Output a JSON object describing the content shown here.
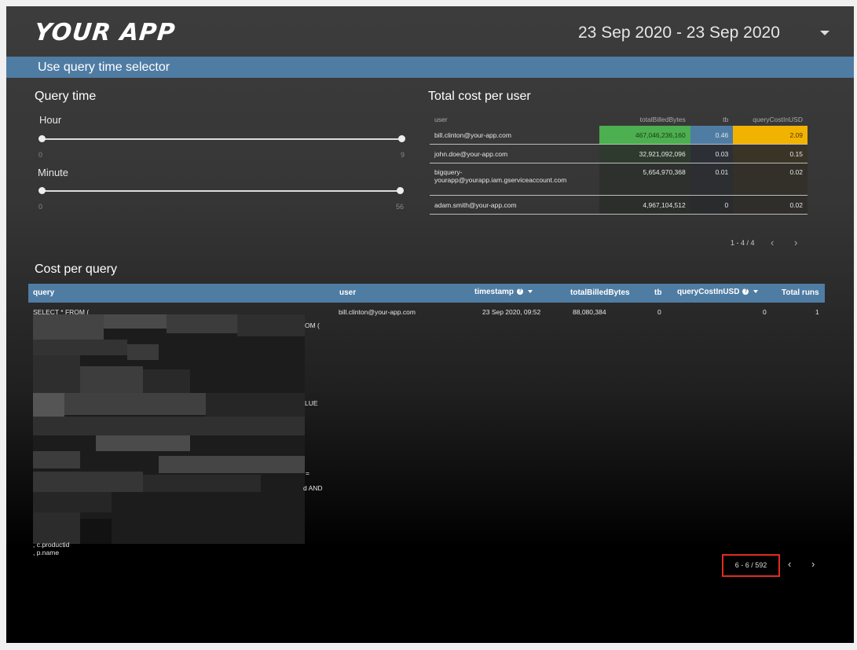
{
  "header": {
    "logo": "YOUR APP",
    "date_range": "23 Sep 2020 - 23 Sep 2020"
  },
  "banner": {
    "text": "Use query time selector"
  },
  "query_time": {
    "title": "Query time",
    "hour": {
      "label": "Hour",
      "min": "0",
      "max": "9"
    },
    "minute": {
      "label": "Minute",
      "min": "0",
      "max": "56"
    }
  },
  "cost_per_user": {
    "title": "Total cost per user",
    "columns": [
      "user",
      "totalBilledBytes",
      "tb",
      "queryCostInUSD"
    ],
    "rows": [
      {
        "user": "bill.clinton@your-app.com",
        "bytes": "467,046,236,160",
        "tb": "0.46",
        "cost": "2.09"
      },
      {
        "user": "john.doe@your-app.com",
        "bytes": "32,921,092,096",
        "tb": "0.03",
        "cost": "0.15"
      },
      {
        "user": "bigquery-yourapp@yourapp.iam.gserviceaccount.com",
        "user_line1": "bigquery-",
        "user_line2": "yourapp@yourapp.iam.gserviceaccount.com",
        "bytes": "5,654,970,368",
        "tb": "0.01",
        "cost": "0.02"
      },
      {
        "user": "adam.smith@your-app.com",
        "bytes": "4,967,104,512",
        "tb": "0",
        "cost": "0.02"
      }
    ],
    "pager": "1 - 4 / 4",
    "colors": {
      "bytes_high": "#4caf50",
      "tb_high": "#4f7ca3",
      "cost_high": "#f2b200"
    }
  },
  "cost_per_query": {
    "title": "Cost per query",
    "columns": {
      "query": "query",
      "user": "user",
      "timestamp": "timestamp",
      "bytes": "totalBilledBytes",
      "tb": "tb",
      "cost": "queryCostInUSD",
      "runs": "Total runs"
    },
    "row": {
      "query_first": "SELECT * FROM (",
      "query_frag_1": "OM (",
      "query_frag_2": "LUE",
      "query_frag_3": "=",
      "query_frag_4": "d AND",
      "query_tail_1": ", c.productid",
      "query_tail_2": ", p.name",
      "user": "bill.clinton@your-app.com",
      "timestamp": "23 Sep 2020, 09:52",
      "bytes": "88,080,384",
      "tb": "0",
      "cost": "0",
      "runs": "1"
    },
    "pager": "6 - 6 / 592"
  },
  "icons": {
    "prev": "‹",
    "next": "›",
    "info": "?"
  }
}
